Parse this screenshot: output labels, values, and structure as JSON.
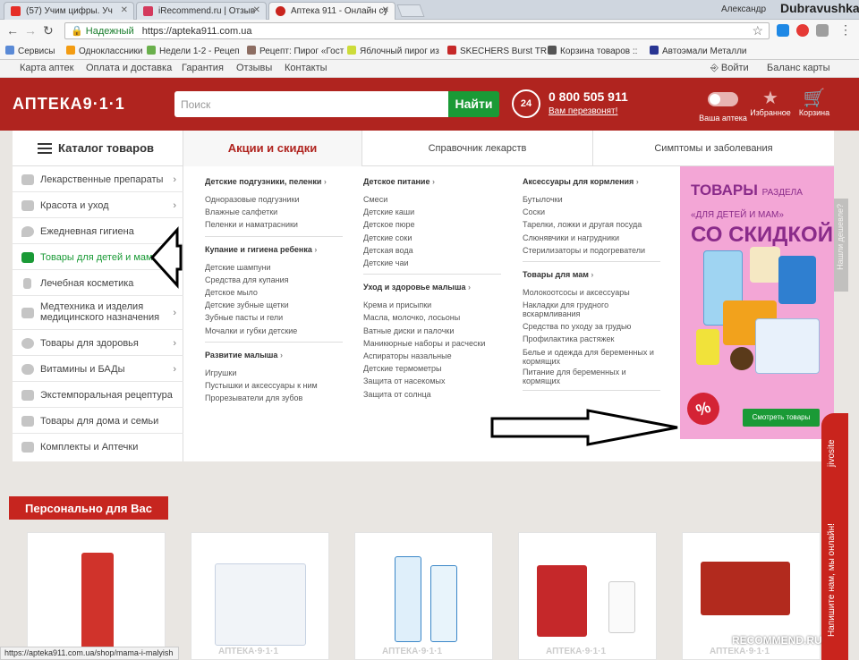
{
  "browser": {
    "tabs": [
      {
        "title": "(57) Учим цифры. Уч",
        "color": "#e52d27"
      },
      {
        "title": "iRecommend.ru | Отзыв",
        "color": "#d43a5d"
      },
      {
        "title": "Аптека 911 - Онлайн су",
        "color": "#c9241d"
      }
    ],
    "user": "Александр",
    "secure_label": "Надежный",
    "url": "https://apteka911.com.ua",
    "bookmarks": [
      "Сервисы",
      "Одноклассники",
      "Недели 1-2 - Рецеп",
      "Рецепт: Пирог «Гост",
      "Яблочный пирог из",
      "SKECHERS Burst TR",
      "Корзина товаров ::",
      "Автоэмали Металли"
    ],
    "status_url": "https://apteka911.com.ua/shop/mama-i-malyish"
  },
  "watermark_top": "Dubravushka",
  "watermark_bottom": "RECOMMEND.RU",
  "topnav": [
    "Карта аптек",
    "Оплата и доставка",
    "Гарантия",
    "Отзывы",
    "Контакты"
  ],
  "topnav_right": {
    "login": "Войти",
    "balance": "Баланс карты"
  },
  "header": {
    "logo": "АПТЕКА9·1·1",
    "search_placeholder": "Поиск",
    "search_button": "Найти",
    "phone_badge": "24",
    "phone": "0 800 505 911",
    "callback": "Вам перезвонят!",
    "icons": [
      {
        "label": "Ваша аптека"
      },
      {
        "label": "Избранное",
        "symbol": "★"
      },
      {
        "label": "Корзина",
        "symbol": "🛒"
      }
    ]
  },
  "catbar": {
    "catalog": "Каталог товаров",
    "tabs": [
      "Акции и скидки",
      "Справочник лекарств",
      "Симптомы и заболевания"
    ]
  },
  "sidemenu": [
    {
      "label": "Лекарственные препараты",
      "chevron": true
    },
    {
      "label": "Красота и уход",
      "chevron": true
    },
    {
      "label": "Ежедневная гигиена",
      "chevron": false
    },
    {
      "label": "Товары для детей и мам",
      "chevron": true,
      "active": true
    },
    {
      "label": "Лечебная косметика",
      "chevron": false
    },
    {
      "label": "Медтехника и изделия медицинского назначения",
      "chevron": true
    },
    {
      "label": "Товары для здоровья",
      "chevron": true
    },
    {
      "label": "Витамины и БАДы",
      "chevron": true
    },
    {
      "label": "Экстемпоральная рецептура",
      "chevron": false
    },
    {
      "label": "Товары для дома и семьи",
      "chevron": false
    },
    {
      "label": "Комплекты и Аптечки",
      "chevron": false
    }
  ],
  "columns": [
    {
      "groups": [
        {
          "title": "Детские подгузники, пеленки",
          "items": [
            "Одноразовые подгузники",
            "Влажные салфетки",
            "Пеленки и наматрасники"
          ]
        },
        {
          "title": "Купание и гигиена ребенка",
          "items": [
            "Детские шампуни",
            "Средства для купания",
            "Детское мыло",
            "Детские зубные щетки",
            "Зубные пасты и гели",
            "Мочалки и губки детские"
          ]
        },
        {
          "title": "Развитие малыша",
          "items": [
            "Игрушки",
            "Пустышки и аксессуары к ним",
            "Прорезыватели для зубов"
          ]
        }
      ]
    },
    {
      "groups": [
        {
          "title": "Детское питание",
          "items": [
            "Смеси",
            "Детские каши",
            "Детское пюре",
            "Детские соки",
            "Детская вода",
            "Детские чаи"
          ]
        },
        {
          "title": "Уход и здоровье малыша",
          "items": [
            "Крема и присыпки",
            "Масла, молочко, лосьоны",
            "Ватные диски и палочки",
            "Маникюрные наборы и расчески",
            "Аспираторы назальные",
            "Детские термометры",
            "Защита от насекомых",
            "Защита от солнца"
          ]
        }
      ]
    },
    {
      "groups": [
        {
          "title": "Аксессуары для кормления",
          "items": [
            "Бутылочки",
            "Соски",
            "Тарелки, ложки и другая посуда",
            "Слюнявчики и нагрудники",
            "Стерилизаторы и подогреватели"
          ]
        },
        {
          "title": "Товары для мам",
          "items": [
            "Молокоотсосы и аксессуары",
            "Накладки для грудного вскармливания",
            "Средства по уходу за грудью",
            "Профилактика растяжек",
            "Белье и одежда для беременных и кормящих",
            "Питание для беременных и кормящих"
          ]
        }
      ]
    }
  ],
  "banner": {
    "line1": "ТОВАРЫ",
    "line1_small": "РАЗДЕЛА",
    "line2": "«ДЛЯ ДЕТЕЙ И МАМ»",
    "line3": "СО СКИДКОЙ",
    "tag": "%",
    "button": "Смотреть товары"
  },
  "personal": {
    "title": "Персонально для Вас",
    "card_logo": "АПТЕКА·9·1·1"
  },
  "jivo": {
    "brand": "jivosite",
    "text": "Напишите нам, мы онлайн!"
  },
  "side_tab": "Нашли дешевле?"
}
